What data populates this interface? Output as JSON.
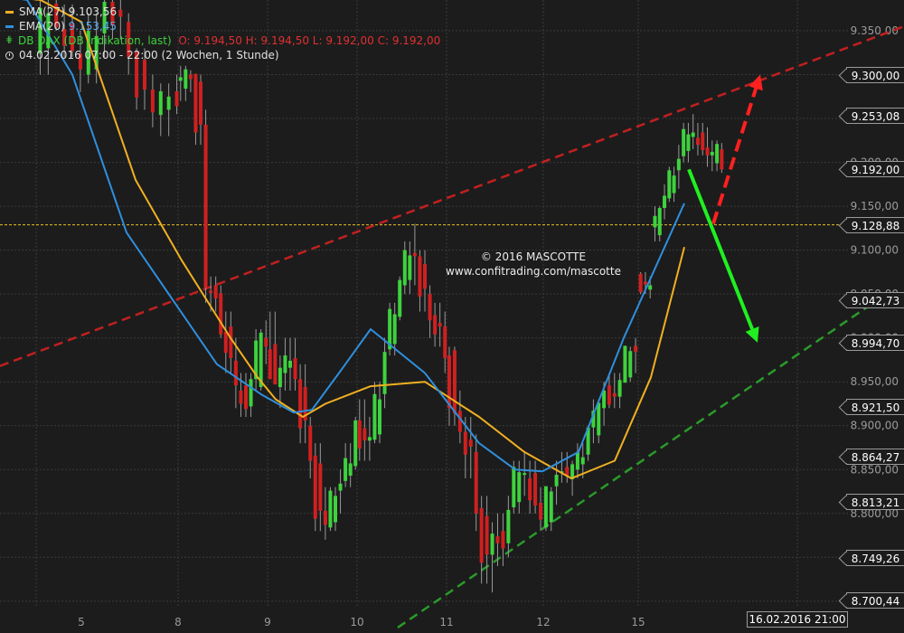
{
  "legend": {
    "sma_label": "SMA(27)",
    "sma_value": "9.103,56",
    "ema_label": "EMA(20)",
    "ema_value": "9.153,45",
    "instrument": "DB DAX (DB Indikation, last)",
    "ohlc": "O: 9.194,50  H: 9.194,50  L: 9.192,00  C: 9.192,00",
    "period": "04.02.2016 07:00 - 22:00 (2 Wochen, 1 Stunde)"
  },
  "watermark": {
    "line1": "© 2016 MASCOTTE",
    "line2": "www.confitrading.com/mascotte"
  },
  "colors": {
    "background": "#1c1c1c",
    "grid": "#3a3a3a",
    "up": "#3ed23e",
    "down": "#d02020",
    "sma": "#f0b020",
    "ema": "#2f8fdd",
    "resistance": "#c02020",
    "support": "#2a9a2a",
    "hline": "#e8c020",
    "arrow_up": "#ff2020",
    "arrow_down": "#20f020"
  },
  "chart_data": {
    "type": "candlestick",
    "instrument": "DB DAX (DB Indikation, last)",
    "interval": "1 Stunde",
    "ylim": [
      8670,
      9390
    ],
    "y_ticks": [
      9350,
      9300,
      9250,
      9200,
      9150,
      9100,
      9050,
      9000,
      8950,
      8900,
      8850,
      8800,
      8750,
      8700
    ],
    "y_tick_labels": [
      "9.350,00",
      "9.300,00",
      "9.250,00",
      "9.200,00",
      "9.150,00",
      "9.100,00",
      "9.050,00",
      "9.000,00",
      "8.950,00",
      "8.900,00",
      "8.850,00",
      "8.800,00",
      "8.750,00",
      "8.700,00"
    ],
    "x_tick_labels": [
      "5",
      "8",
      "9",
      "10",
      "11",
      "12",
      "15"
    ],
    "price_tags": [
      {
        "value": 9300.0,
        "label": "9.300,00"
      },
      {
        "value": 9253.08,
        "label": "9.253,08"
      },
      {
        "value": 9192.0,
        "label": "9.192,00"
      },
      {
        "value": 9128.88,
        "label": "9.128,88"
      },
      {
        "value": 9042.73,
        "label": "9.042,73"
      },
      {
        "value": 8994.7,
        "label": "8.994,70"
      },
      {
        "value": 8921.5,
        "label": "8.921,50"
      },
      {
        "value": 8864.27,
        "label": "8.864,27"
      },
      {
        "value": 8813.21,
        "label": "8.813,21"
      },
      {
        "value": 8749.26,
        "label": "8.749,26"
      },
      {
        "value": 8700.44,
        "label": "8.700,44"
      }
    ],
    "hline": 9128.88,
    "time_tag": "16.02.2016 21:00",
    "sessions": [
      {
        "label": "5",
        "anchors": [
          [
            9330,
            9390,
            9300,
            9370
          ],
          [
            9375,
            9390,
            9350,
            9360
          ],
          [
            9355,
            9380,
            9320,
            9330
          ],
          [
            9330,
            9350,
            9280,
            9300
          ],
          [
            9300,
            9370,
            9290,
            9350
          ],
          [
            9350,
            9390,
            9320,
            9380
          ],
          [
            9380,
            9390,
            9340,
            9360
          ],
          [
            9360,
            9370,
            9300,
            9320
          ],
          [
            9320,
            9330,
            9260,
            9280
          ],
          [
            9280,
            9300,
            9240,
            9260
          ],
          [
            9260,
            9290,
            9230,
            9275
          ],
          [
            9275,
            9300,
            9255,
            9270
          ]
        ]
      },
      {
        "label": "8",
        "anchors": [
          [
            9290,
            9310,
            9270,
            9300
          ],
          [
            9300,
            9305,
            9280,
            9295
          ],
          [
            9295,
            9300,
            9220,
            9240
          ],
          [
            9240,
            9260,
            9040,
            9060
          ],
          [
            9060,
            9070,
            9030,
            9045
          ],
          [
            9045,
            9060,
            9000,
            9010
          ],
          [
            9010,
            9030,
            8960,
            8980
          ],
          [
            8980,
            9000,
            8920,
            8940
          ],
          [
            8940,
            8960,
            8910,
            8925
          ],
          [
            8925,
            8960,
            8910,
            8950
          ],
          [
            8950,
            9010,
            8940,
            9000
          ],
          [
            9000,
            9020,
            8970,
            8990
          ]
        ]
      },
      {
        "label": "9",
        "anchors": [
          [
            8990,
            9030,
            8960,
            8950
          ],
          [
            8950,
            8980,
            8920,
            8960
          ],
          [
            8960,
            9000,
            8940,
            8980
          ],
          [
            8980,
            9000,
            8940,
            8950
          ],
          [
            8950,
            8970,
            8880,
            8900
          ],
          [
            8900,
            8910,
            8840,
            8860
          ],
          [
            8860,
            8880,
            8780,
            8800
          ],
          [
            8800,
            8830,
            8770,
            8790
          ],
          [
            8790,
            8830,
            8780,
            8820
          ],
          [
            8820,
            8850,
            8800,
            8840
          ],
          [
            8840,
            8880,
            8830,
            8860
          ],
          [
            8860,
            8910,
            8850,
            8900
          ]
        ]
      },
      {
        "label": "10",
        "anchors": [
          [
            8900,
            8930,
            8860,
            8880
          ],
          [
            8880,
            8910,
            8860,
            8890
          ],
          [
            8890,
            8950,
            8880,
            8930
          ],
          [
            8930,
            9000,
            8920,
            8990
          ],
          [
            8990,
            9040,
            8980,
            9030
          ],
          [
            9030,
            9070,
            9020,
            9060
          ],
          [
            9060,
            9110,
            9050,
            9100
          ],
          [
            9100,
            9130,
            9060,
            9090
          ],
          [
            9090,
            9100,
            9030,
            9050
          ],
          [
            9050,
            9060,
            9000,
            9020
          ],
          [
            9020,
            9040,
            8990,
            9010
          ],
          [
            9010,
            9030,
            8960,
            8980
          ]
        ]
      },
      {
        "label": "11",
        "anchors": [
          [
            8980,
            8990,
            8900,
            8920
          ],
          [
            8920,
            8940,
            8880,
            8890
          ],
          [
            8890,
            8910,
            8840,
            8870
          ],
          [
            8870,
            8890,
            8780,
            8800
          ],
          [
            8800,
            8820,
            8720,
            8750
          ],
          [
            8750,
            8790,
            8710,
            8780
          ],
          [
            8780,
            8800,
            8740,
            8760
          ],
          [
            8760,
            8820,
            8750,
            8810
          ],
          [
            8810,
            8860,
            8800,
            8850
          ],
          [
            8850,
            8870,
            8820,
            8840
          ],
          [
            8840,
            8860,
            8800,
            8815
          ],
          [
            8815,
            8830,
            8780,
            8790
          ]
        ]
      },
      {
        "label": "12",
        "anchors": [
          [
            8790,
            8830,
            8780,
            8825
          ],
          [
            8825,
            8860,
            8810,
            8850
          ],
          [
            8850,
            8870,
            8835,
            8845
          ],
          [
            8845,
            8860,
            8820,
            8850
          ],
          [
            8850,
            8880,
            8840,
            8870
          ],
          [
            8870,
            8900,
            8860,
            8895
          ],
          [
            8895,
            8930,
            8880,
            8920
          ],
          [
            8920,
            8950,
            8900,
            8940
          ],
          [
            8940,
            8960,
            8920,
            8930
          ],
          [
            8930,
            8960,
            8920,
            8955
          ],
          [
            8955,
            8990,
            8950,
            8985
          ],
          [
            8985,
            9000,
            8960,
            8990
          ]
        ]
      },
      {
        "label": "15",
        "anchors": [
          [
            9070,
            9075,
            9050,
            9055
          ],
          [
            9055,
            9070,
            9045,
            9060
          ],
          [
            9120,
            9150,
            9110,
            9145
          ],
          [
            9145,
            9175,
            9135,
            9165
          ],
          [
            9165,
            9195,
            9155,
            9185
          ],
          [
            9185,
            9220,
            9170,
            9210
          ],
          [
            9210,
            9245,
            9200,
            9235
          ],
          [
            9235,
            9255,
            9215,
            9228
          ],
          [
            9228,
            9245,
            9208,
            9220
          ],
          [
            9220,
            9240,
            9195,
            9205
          ],
          [
            9205,
            9225,
            9190,
            9215
          ],
          [
            9215,
            9222,
            9188,
            9192
          ]
        ]
      }
    ],
    "series": [
      {
        "name": "SMA(27)",
        "x": [
          0,
          45,
          90,
          150,
          200,
          255,
          285,
          305,
          335,
          360,
          410,
          470,
          530,
          580,
          632,
          680,
          720,
          757
        ],
        "y": [
          9390,
          9385,
          9360,
          9180,
          9090,
          9000,
          8955,
          8930,
          8910,
          8925,
          8945,
          8950,
          8910,
          8870,
          8840,
          8860,
          8955,
          9103.56
        ]
      },
      {
        "name": "EMA(20)",
        "x": [
          0,
          30,
          80,
          140,
          200,
          240,
          290,
          325,
          345,
          375,
          410,
          470,
          530,
          570,
          600,
          640,
          690,
          757
        ],
        "y": [
          9390,
          9385,
          9300,
          9120,
          9030,
          8970,
          8935,
          8915,
          8918,
          8960,
          9010,
          8960,
          8880,
          8850,
          8848,
          8870,
          9000,
          9153.45
        ]
      }
    ],
    "trendlines": [
      {
        "name": "resistance",
        "style": "dashed",
        "from": {
          "x": 0,
          "y": 8968
        },
        "to": {
          "x": 1000,
          "y": 9355
        }
      },
      {
        "name": "support",
        "style": "dashed",
        "from": {
          "x": 440,
          "y": 8670
        },
        "to": {
          "x": 970,
          "y": 9042.73
        }
      }
    ],
    "arrows": [
      {
        "name": "up",
        "style": "dashed",
        "from": {
          "x": 789,
          "y": 9130
        },
        "to": {
          "x": 841,
          "y": 9300
        }
      },
      {
        "name": "down",
        "style": "solid",
        "from": {
          "x": 762,
          "y": 9192
        },
        "to": {
          "x": 838,
          "y": 8994.7
        }
      }
    ]
  }
}
